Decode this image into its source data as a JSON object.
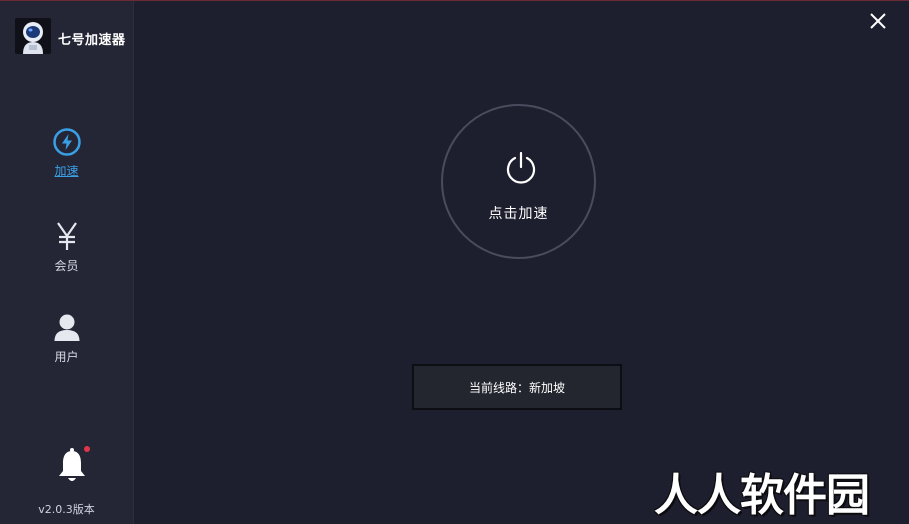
{
  "app": {
    "title": "七号加速器",
    "version": "v2.0.3版本"
  },
  "sidebar": {
    "items": [
      {
        "label": "加速",
        "icon": "lightning-icon",
        "active": true
      },
      {
        "label": "会员",
        "icon": "yen-icon",
        "active": false
      },
      {
        "label": "用户",
        "icon": "user-icon",
        "active": false
      }
    ]
  },
  "main": {
    "power_label": "点击加速",
    "route_label": "当前线路：新加坡"
  },
  "watermark": {
    "text": "人人软件园"
  },
  "colors": {
    "accent": "#3aa0e6",
    "notification": "#e0364a",
    "background": "#1e1f2e",
    "sidebar": "#242636"
  }
}
